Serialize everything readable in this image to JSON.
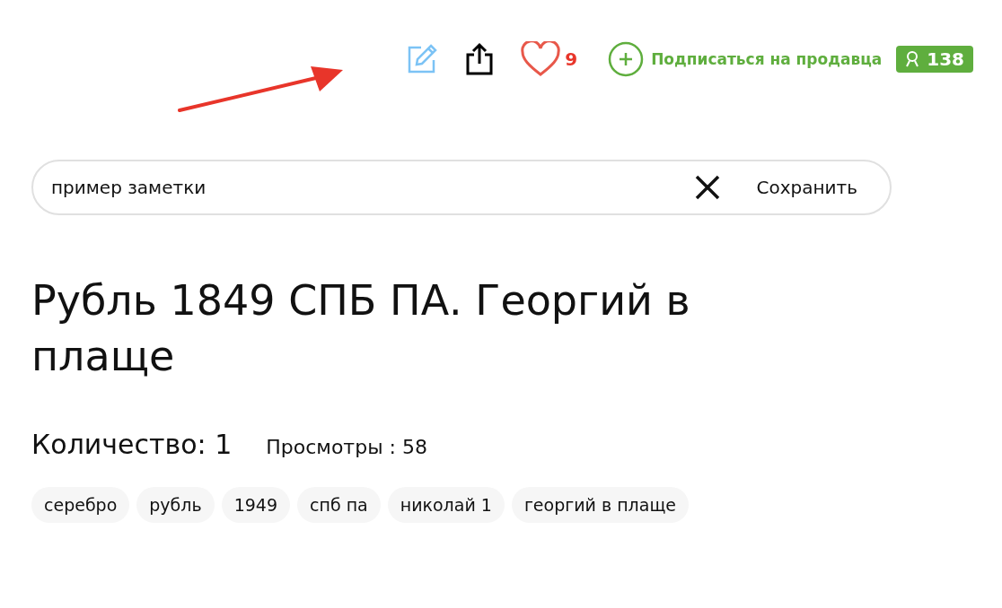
{
  "actions": {
    "likes": "9",
    "subscribe": "Подписаться на продавца",
    "subscribers": "138"
  },
  "note": {
    "value": "пример заметки",
    "save": "Сохранить"
  },
  "title": "Рубль 1849 СПБ ПА. Георгий в плаще",
  "quantity": "Количество: 1",
  "views": "Просмотры : 58",
  "tags": [
    "серебро",
    "рубль",
    "1949",
    "спб па",
    "николай 1",
    "георгий в плаще"
  ]
}
